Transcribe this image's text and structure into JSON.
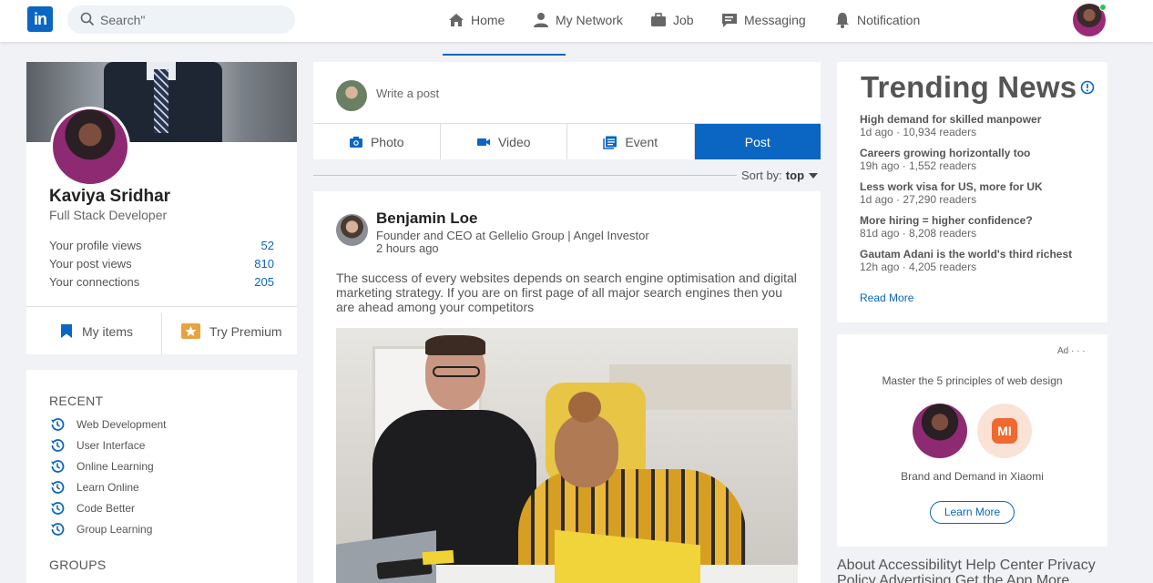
{
  "nav": {
    "logo": "in",
    "search_placeholder": "Search\"",
    "items": [
      "Home",
      "My Network",
      "Job",
      "Messaging",
      "Notification"
    ]
  },
  "profile": {
    "name": "Kaviya Sridhar",
    "title": "Full Stack Developer",
    "stats": [
      {
        "label": "Your profile views",
        "value": "52"
      },
      {
        "label": "Your post views",
        "value": "810"
      },
      {
        "label": "Your connections",
        "value": "205"
      }
    ],
    "my_items": "My items",
    "try_premium": "Try Premium"
  },
  "recent": {
    "title": "RECENT",
    "items": [
      "Web Development",
      "User Interface",
      "Online Learning",
      "Learn Online",
      "Code Better",
      "Group Learning"
    ],
    "groups_title": "GROUPS"
  },
  "composer": {
    "placeholder": "Write a post",
    "actions": [
      "Photo",
      "Video",
      "Event",
      "Post"
    ]
  },
  "sort": {
    "label": "Sort by:",
    "value": "top"
  },
  "post": {
    "author": "Benjamin Loe",
    "subtitle": "Founder and CEO at Gellelio Group | Angel Investor",
    "time": "2 hours ago",
    "body": "The success of every websites depends on search engine optimisation and digital marketing strategy. If you are on first page of all major search engines then you are ahead among your competitors"
  },
  "news": {
    "title": "Trending News",
    "items": [
      {
        "headline": "High demand for skilled manpower",
        "meta": "1d ago · 10,934 readers"
      },
      {
        "headline": "Careers growing horizontally too",
        "meta": "19h ago · 1,552 readers"
      },
      {
        "headline": "Less work visa for US, more for UK",
        "meta": "1d ago · 27,290 readers"
      },
      {
        "headline": "More hiring = higher confidence?",
        "meta": "81d ago · 8,208 readers"
      },
      {
        "headline": "Gautam Adani is the world's third richest",
        "meta": "12h ago · 4,205 readers"
      }
    ],
    "read_more": "Read More"
  },
  "ad": {
    "label": "Ad · · ·",
    "headline": "Master the 5 principles of web design",
    "brand_logo": "MI",
    "subtitle": "Brand and Demand in Xiaomi",
    "cta": "Learn More"
  },
  "footer": {
    "links": [
      "About",
      "Accessibilityt",
      "Help Center",
      "Privacy Policy",
      "Advertising",
      "Get the App",
      "More"
    ]
  },
  "colors": {
    "accent": "#0a66c2",
    "premium": "#e7a33e",
    "online": "#2ec15a"
  }
}
